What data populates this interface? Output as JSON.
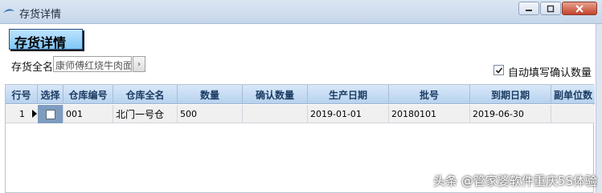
{
  "window": {
    "title": "存货详情",
    "controls": [
      "minimize-icon",
      "restore-icon",
      "close-icon"
    ]
  },
  "panel": {
    "title": "存货详情",
    "name_label": "存货全名",
    "name_value": "康师傅红烧牛肉面",
    "auto_fill_label": "自动填写确认数量",
    "auto_fill_checked": true
  },
  "grid": {
    "columns": [
      "行号",
      "选择",
      "仓库编号",
      "仓库全名",
      "数量",
      "确认数量",
      "生产日期",
      "批号",
      "到期日期",
      "副单位数"
    ],
    "rows": [
      {
        "row_no": "1",
        "selected": false,
        "warehouse_code": "001",
        "warehouse_name": "北门一号仓",
        "quantity": "500",
        "confirm_qty": "",
        "production_date": "2019-01-01",
        "batch_no": "20180101",
        "expiry_date": "2019-06-30",
        "sub_unit_qty": ""
      }
    ]
  },
  "watermark": "头条 @管家婆软件重庆5S体验"
}
